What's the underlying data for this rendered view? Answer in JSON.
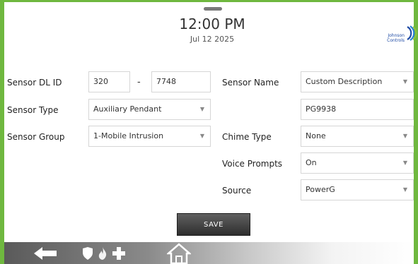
{
  "header": {
    "time": "12:00 PM",
    "date": "Jul 12 2025",
    "brand_line1": "Johnson",
    "brand_line2": "Controls",
    "brand_color": "#1f4ba5"
  },
  "left": {
    "dl_id": {
      "label": "Sensor DL ID",
      "part1": "320",
      "separator": "-",
      "part2": "7748"
    },
    "type": {
      "label": "Sensor Type",
      "value": "Auxiliary Pendant"
    },
    "group": {
      "label": "Sensor Group",
      "value": "1-Mobile Intrusion"
    }
  },
  "right": {
    "name": {
      "label": "Sensor Name",
      "value": "Custom Description"
    },
    "custom_text": {
      "value": "PG9938"
    },
    "chime": {
      "label": "Chime Type",
      "value": "None"
    },
    "voice": {
      "label": "Voice Prompts",
      "value": "On"
    },
    "source": {
      "label": "Source",
      "value": "PowerG"
    }
  },
  "save_label": "SAVE",
  "icons": {
    "dropdown": "chevron-down-icon",
    "back": "back-arrow-icon",
    "emergency": [
      "shield-icon",
      "fire-icon",
      "medical-cross-icon"
    ],
    "home": "home-icon"
  },
  "colors": {
    "frame": "#6fb83f",
    "save_button": "#3a3a3a"
  }
}
